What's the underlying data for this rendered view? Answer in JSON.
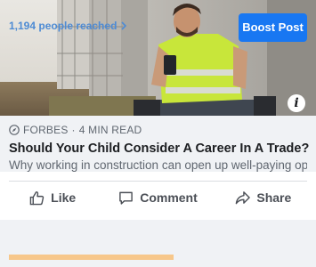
{
  "hero": {
    "alt_subject": "photo",
    "info_glyph": "i"
  },
  "link_preview": {
    "source_icon": "compass-icon",
    "source": "FORBES",
    "separator": "·",
    "read_time": "4 MIN READ",
    "headline": "Should Your Child Consider A Career In A Trade?",
    "description": "Why working in construction can open up well-paying opp..."
  },
  "actions": {
    "like_label": "Like",
    "comment_label": "Comment",
    "share_label": "Share"
  },
  "footer": {
    "reach_text": "1,194 people reached",
    "boost_label": "Boost Post",
    "progress_fraction": 0.74
  },
  "colors": {
    "brand_blue": "#1877f2",
    "link_blue": "#4e8bd4",
    "panel_gray": "#f0f2f5",
    "progress": "#f7c78a"
  }
}
